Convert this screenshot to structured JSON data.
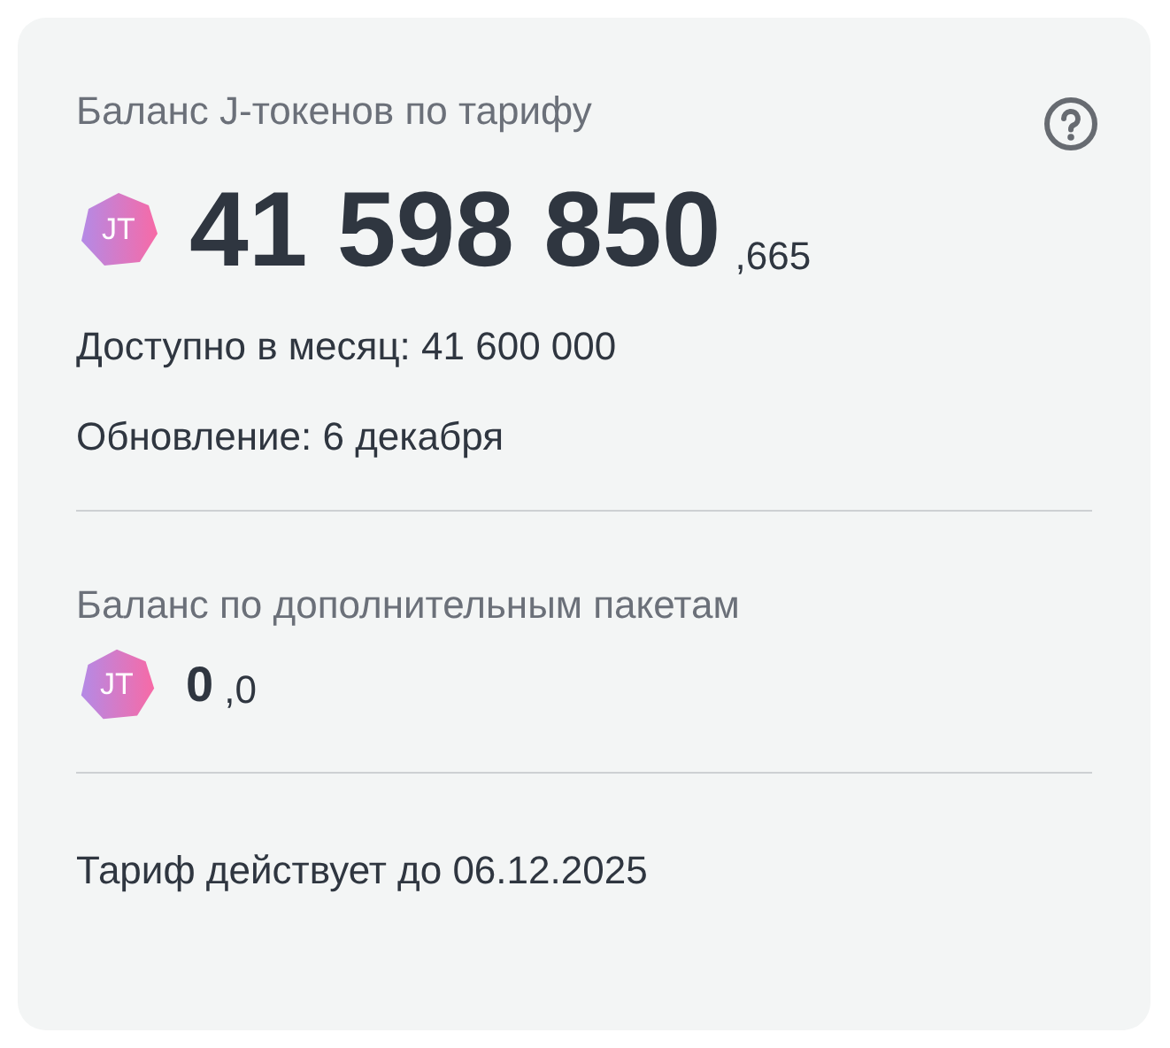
{
  "tariff": {
    "title": "Баланс J-токенов по тарифу",
    "badge": "JT",
    "amount": "41 598 850",
    "fraction": ",665",
    "monthly": "Доступно в месяц: 41 600 000",
    "renewal": "Обновление: 6 декабря"
  },
  "packages": {
    "title": "Баланс по дополнительным пакетам",
    "badge": "JT",
    "amount": "0",
    "fraction": ",0"
  },
  "footer": "Тариф действует до 06.12.2025"
}
